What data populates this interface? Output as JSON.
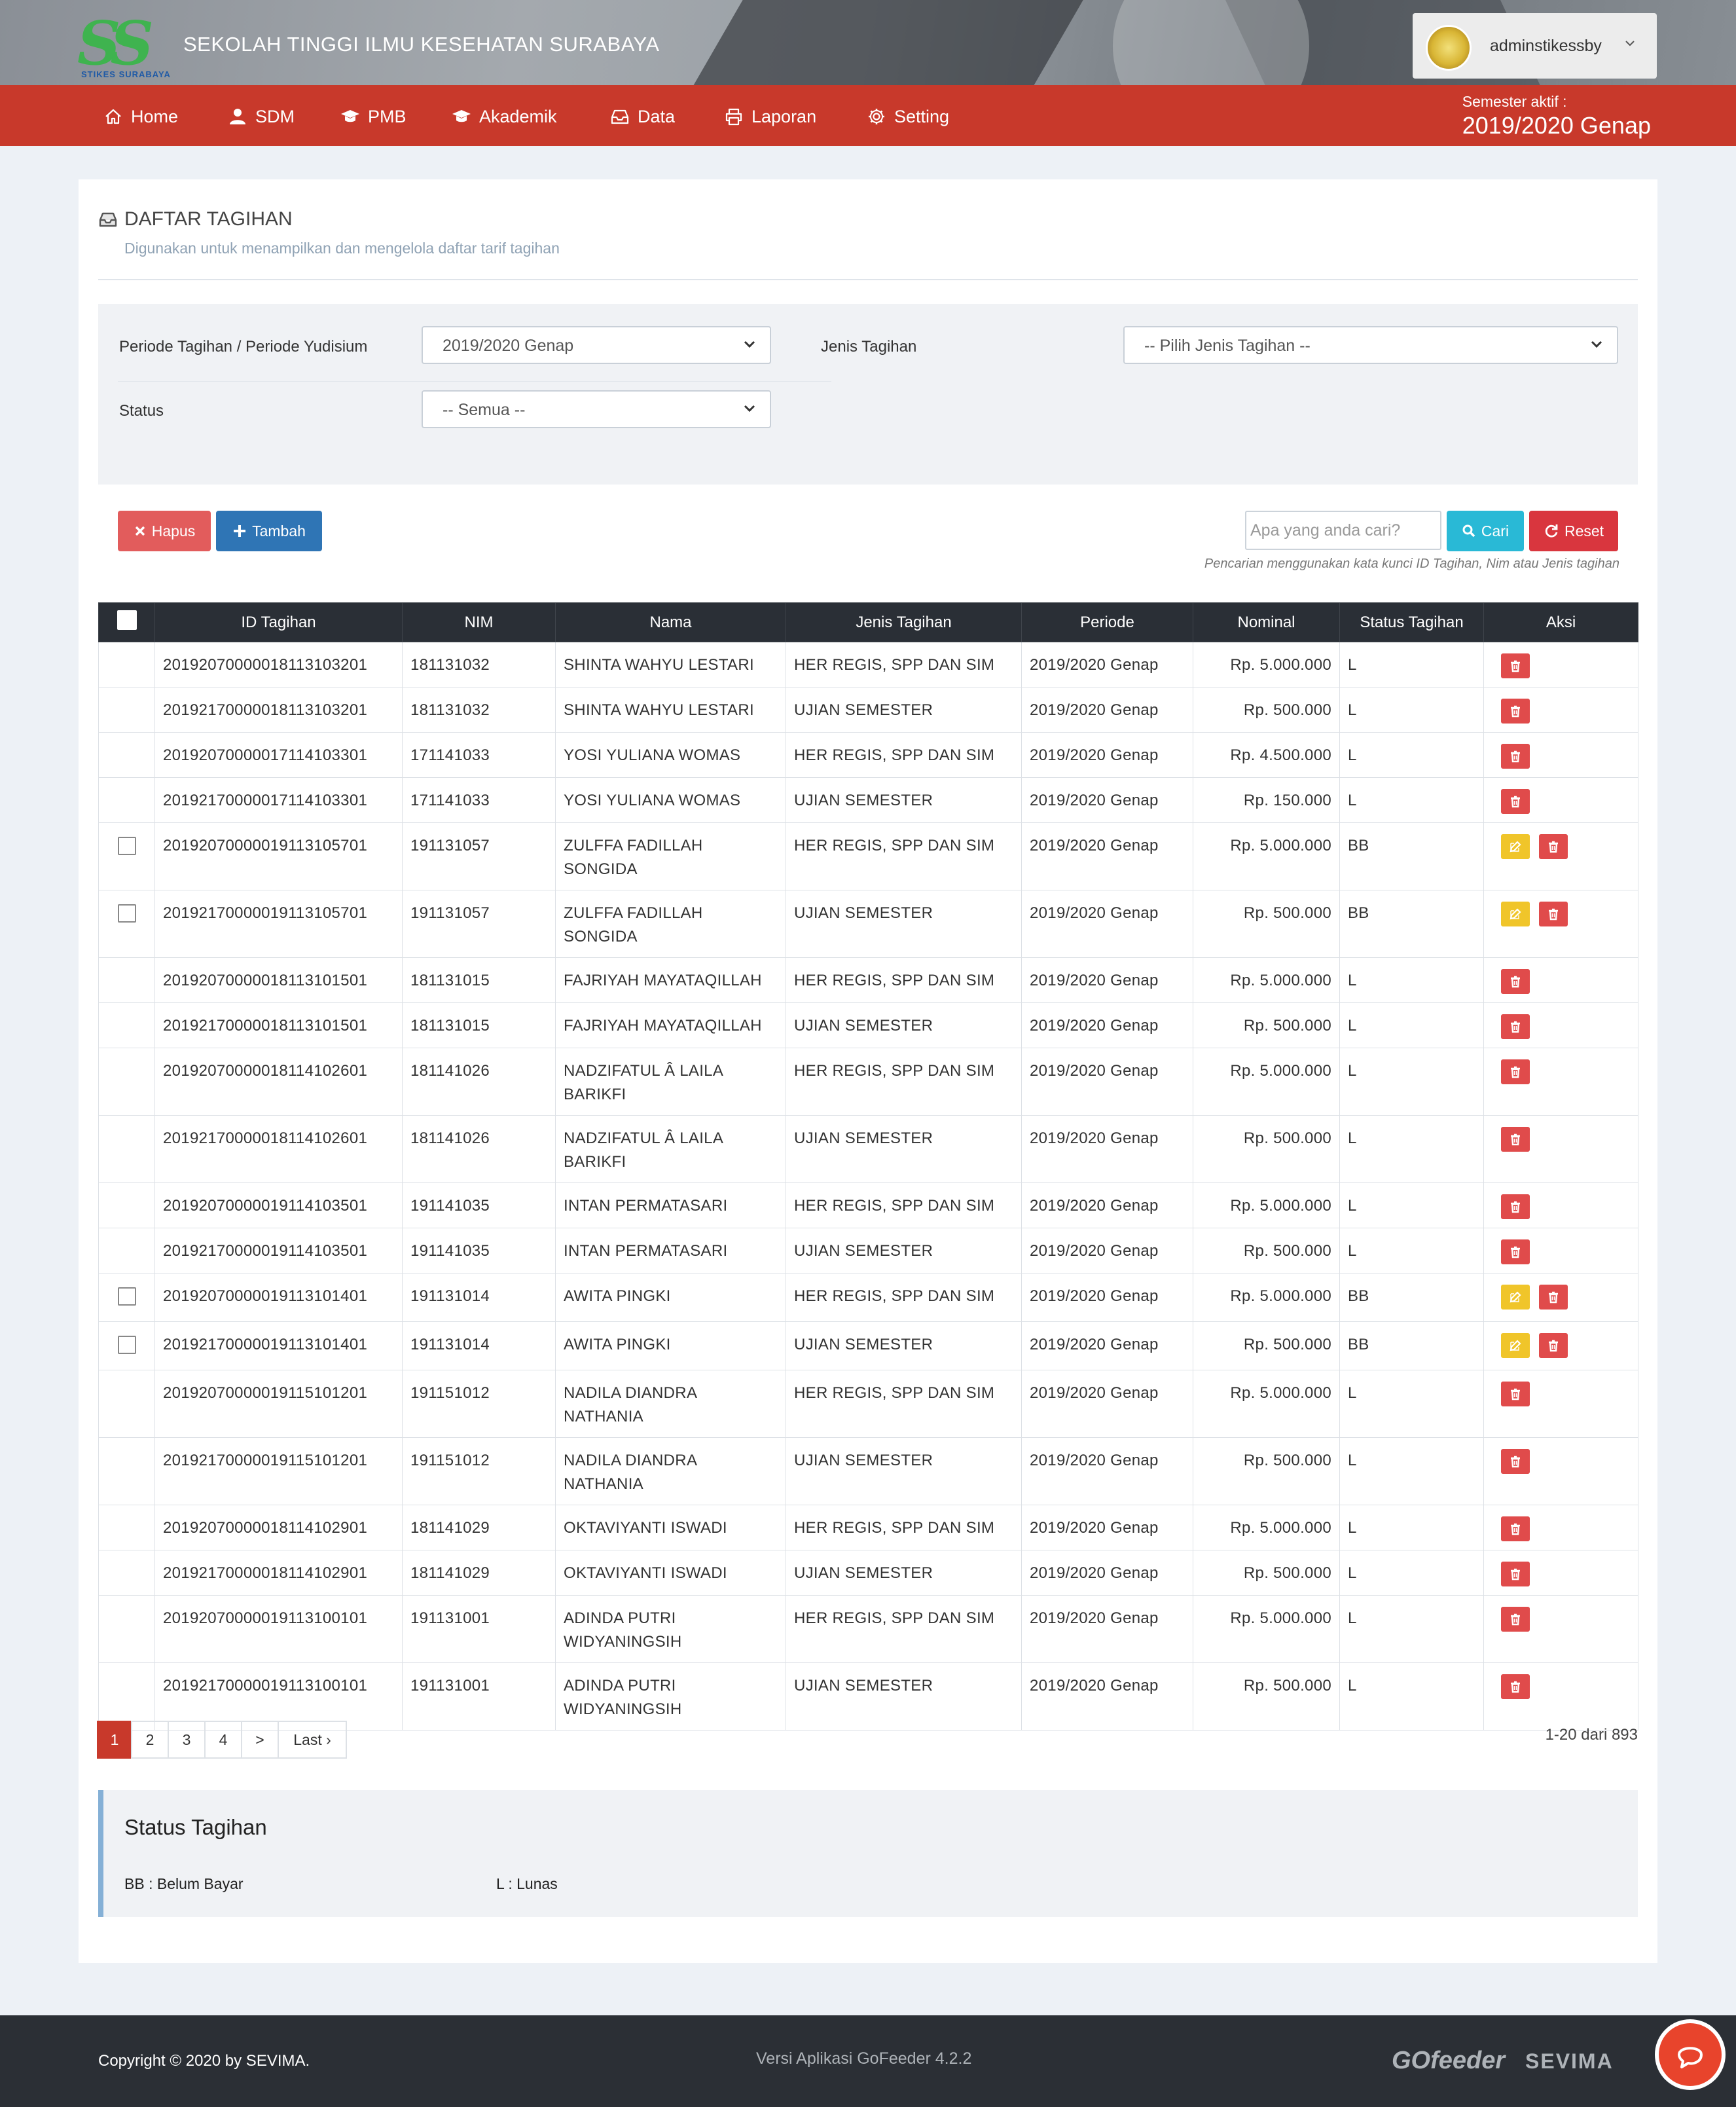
{
  "app": {
    "logo_text": "SS",
    "logo_sub": "STIKES SURABAYA",
    "title": "SEKOLAH TINGGI ILMU KESEHATAN SURABAYA"
  },
  "user": {
    "name": "adminstikessby",
    "avatar_icon": "university-seal-icon",
    "dropdown_icon": "chevron-down-icon"
  },
  "nav": {
    "items": [
      {
        "label": "Home",
        "icon": "home-icon"
      },
      {
        "label": "SDM",
        "icon": "user-icon"
      },
      {
        "label": "PMB",
        "icon": "graduation-cap-icon"
      },
      {
        "label": "Akademik",
        "icon": "graduation-cap-icon"
      },
      {
        "label": "Data",
        "icon": "inbox-icon"
      },
      {
        "label": "Laporan",
        "icon": "printer-icon"
      },
      {
        "label": "Setting",
        "icon": "gear-icon"
      }
    ],
    "semester_label": "Semester aktif :",
    "semester_value": "2019/2020 Genap"
  },
  "page": {
    "title": "DAFTAR TAGIHAN",
    "subtitle": "Digunakan untuk menampilkan dan mengelola daftar tarif tagihan"
  },
  "filters": {
    "periode_label": "Periode Tagihan / Periode Yudisium",
    "periode_value": "2019/2020 Genap",
    "jenis_label": "Jenis Tagihan",
    "jenis_value": "-- Pilih Jenis Tagihan --",
    "status_label": "Status",
    "status_value": "-- Semua --"
  },
  "actions": {
    "hapus": "Hapus",
    "tambah": "Tambah",
    "search_placeholder": "Apa yang anda cari?",
    "cari": "Cari",
    "reset": "Reset",
    "hint": "Pencarian menggunakan kata kunci ID Tagihan, Nim atau Jenis tagihan"
  },
  "table": {
    "headers": [
      "ID Tagihan",
      "NIM",
      "Nama",
      "Jenis Tagihan",
      "Periode",
      "Nominal",
      "Status Tagihan",
      "Aksi"
    ],
    "rows": [
      {
        "id": "20192070000018113103201",
        "nim": "181131032",
        "nama": "SHINTA WAHYU LESTARI",
        "jenis": "HER REGIS, SPP DAN SIM",
        "periode": "2019/2020 Genap",
        "nominal": "Rp. 5.000.000",
        "status": "L"
      },
      {
        "id": "20192170000018113103201",
        "nim": "181131032",
        "nama": "SHINTA WAHYU LESTARI",
        "jenis": "UJIAN SEMESTER",
        "periode": "2019/2020 Genap",
        "nominal": "Rp. 500.000",
        "status": "L"
      },
      {
        "id": "20192070000017114103301",
        "nim": "171141033",
        "nama": "YOSI YULIANA WOMAS",
        "jenis": "HER REGIS, SPP DAN SIM",
        "periode": "2019/2020 Genap",
        "nominal": "Rp. 4.500.000",
        "status": "L"
      },
      {
        "id": "20192170000017114103301",
        "nim": "171141033",
        "nama": "YOSI YULIANA WOMAS",
        "jenis": "UJIAN SEMESTER",
        "periode": "2019/2020 Genap",
        "nominal": "Rp. 150.000",
        "status": "L"
      },
      {
        "id": "20192070000019113105701",
        "nim": "191131057",
        "nama": "ZULFFA FADILLAH SONGIDA",
        "jenis": "HER REGIS, SPP DAN SIM",
        "periode": "2019/2020 Genap",
        "nominal": "Rp. 5.000.000",
        "status": "BB"
      },
      {
        "id": "20192170000019113105701",
        "nim": "191131057",
        "nama": "ZULFFA FADILLAH SONGIDA",
        "jenis": "UJIAN SEMESTER",
        "periode": "2019/2020 Genap",
        "nominal": "Rp. 500.000",
        "status": "BB"
      },
      {
        "id": "20192070000018113101501",
        "nim": "181131015",
        "nama": "FAJRIYAH MAYATAQILLAH",
        "jenis": "HER REGIS, SPP DAN SIM",
        "periode": "2019/2020 Genap",
        "nominal": "Rp. 5.000.000",
        "status": "L"
      },
      {
        "id": "20192170000018113101501",
        "nim": "181131015",
        "nama": "FAJRIYAH MAYATAQILLAH",
        "jenis": "UJIAN SEMESTER",
        "periode": "2019/2020 Genap",
        "nominal": "Rp. 500.000",
        "status": "L"
      },
      {
        "id": "20192070000018114102601",
        "nim": "181141026",
        "nama": "NADZIFATUL Â LAILA BARIKFI",
        "jenis": "HER REGIS, SPP DAN SIM",
        "periode": "2019/2020 Genap",
        "nominal": "Rp. 5.000.000",
        "status": "L"
      },
      {
        "id": "20192170000018114102601",
        "nim": "181141026",
        "nama": "NADZIFATUL Â LAILA BARIKFI",
        "jenis": "UJIAN SEMESTER",
        "periode": "2019/2020 Genap",
        "nominal": "Rp. 500.000",
        "status": "L"
      },
      {
        "id": "20192070000019114103501",
        "nim": "191141035",
        "nama": "INTAN PERMATASARI",
        "jenis": "HER REGIS, SPP DAN SIM",
        "periode": "2019/2020 Genap",
        "nominal": "Rp. 5.000.000",
        "status": "L"
      },
      {
        "id": "20192170000019114103501",
        "nim": "191141035",
        "nama": "INTAN PERMATASARI",
        "jenis": "UJIAN SEMESTER",
        "periode": "2019/2020 Genap",
        "nominal": "Rp. 500.000",
        "status": "L"
      },
      {
        "id": "20192070000019113101401",
        "nim": "191131014",
        "nama": "AWITA PINGKI",
        "jenis": "HER REGIS, SPP DAN SIM",
        "periode": "2019/2020 Genap",
        "nominal": "Rp. 5.000.000",
        "status": "BB"
      },
      {
        "id": "20192170000019113101401",
        "nim": "191131014",
        "nama": "AWITA PINGKI",
        "jenis": "UJIAN SEMESTER",
        "periode": "2019/2020 Genap",
        "nominal": "Rp. 500.000",
        "status": "BB"
      },
      {
        "id": "20192070000019115101201",
        "nim": "191151012",
        "nama": "NADILA DIANDRA NATHANIA",
        "jenis": "HER REGIS, SPP DAN SIM",
        "periode": "2019/2020 Genap",
        "nominal": "Rp. 5.000.000",
        "status": "L"
      },
      {
        "id": "20192170000019115101201",
        "nim": "191151012",
        "nama": "NADILA DIANDRA NATHANIA",
        "jenis": "UJIAN SEMESTER",
        "periode": "2019/2020 Genap",
        "nominal": "Rp. 500.000",
        "status": "L"
      },
      {
        "id": "20192070000018114102901",
        "nim": "181141029",
        "nama": "OKTAVIYANTI ISWADI",
        "jenis": "HER REGIS, SPP DAN SIM",
        "periode": "2019/2020 Genap",
        "nominal": "Rp. 5.000.000",
        "status": "L"
      },
      {
        "id": "20192170000018114102901",
        "nim": "181141029",
        "nama": "OKTAVIYANTI ISWADI",
        "jenis": "UJIAN SEMESTER",
        "periode": "2019/2020 Genap",
        "nominal": "Rp. 500.000",
        "status": "L"
      },
      {
        "id": "20192070000019113100101",
        "nim": "191131001",
        "nama": "ADINDA PUTRI WIDYANINGSIH",
        "jenis": "HER REGIS, SPP DAN SIM",
        "periode": "2019/2020 Genap",
        "nominal": "Rp. 5.000.000",
        "status": "L"
      },
      {
        "id": "20192170000019113100101",
        "nim": "191131001",
        "nama": "ADINDA PUTRI WIDYANINGSIH",
        "jenis": "UJIAN SEMESTER",
        "periode": "2019/2020 Genap",
        "nominal": "Rp. 500.000",
        "status": "L"
      }
    ]
  },
  "pagination": {
    "pages": [
      "1",
      "2",
      "3",
      "4",
      ">",
      "Last ›"
    ],
    "active": "1",
    "count": "1-20 dari 893"
  },
  "legend": {
    "title": "Status Tagihan",
    "bb": "BB : Belum Bayar",
    "l": "L : Lunas"
  },
  "footer": {
    "copyright": "Copyright © 2020 by SEVIMA.",
    "version": "Versi Aplikasi GoFeeder 4.2.2",
    "gofeeder": "GOfeeder",
    "sevima": "SEVIMA"
  },
  "colors": {
    "accent": "#c8392b",
    "header_dark": "#2a2f36",
    "delete": "#e04b4b",
    "edit": "#f0c52a",
    "cari": "#29b9d6",
    "tambah": "#2f75b5"
  }
}
